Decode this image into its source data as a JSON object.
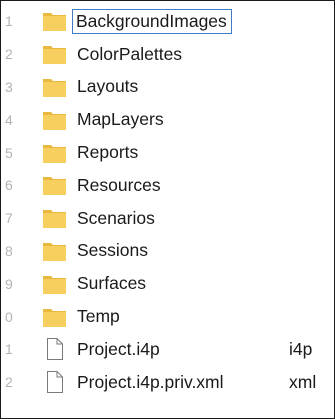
{
  "file_list": {
    "rows": [
      {
        "num": "1",
        "name": "BackgroundImages",
        "kind": "folder",
        "type": "",
        "selected": true
      },
      {
        "num": "2",
        "name": "ColorPalettes",
        "kind": "folder",
        "type": ""
      },
      {
        "num": "3",
        "name": "Layouts",
        "kind": "folder",
        "type": ""
      },
      {
        "num": "4",
        "name": "MapLayers",
        "kind": "folder",
        "type": ""
      },
      {
        "num": "5",
        "name": "Reports",
        "kind": "folder",
        "type": ""
      },
      {
        "num": "6",
        "name": "Resources",
        "kind": "folder",
        "type": ""
      },
      {
        "num": "7",
        "name": "Scenarios",
        "kind": "folder",
        "type": ""
      },
      {
        "num": "8",
        "name": "Sessions",
        "kind": "folder",
        "type": ""
      },
      {
        "num": "9",
        "name": "Surfaces",
        "kind": "folder",
        "type": ""
      },
      {
        "num": "0",
        "name": "Temp",
        "kind": "folder",
        "type": ""
      },
      {
        "num": "1",
        "name": "Project.i4p",
        "kind": "file",
        "type": "i4p"
      },
      {
        "num": "2",
        "name": "Project.i4p.priv.xml",
        "kind": "file",
        "type": "xml"
      }
    ]
  },
  "icons": {
    "folder": "folder-icon",
    "file": "file-icon"
  },
  "colors": {
    "folder_fill": "#F7CF5E",
    "folder_tab": "#E8B93E",
    "line_number": "#B4B4B4",
    "selection_border": "#3C7DC4",
    "text": "#1A1A1A"
  }
}
